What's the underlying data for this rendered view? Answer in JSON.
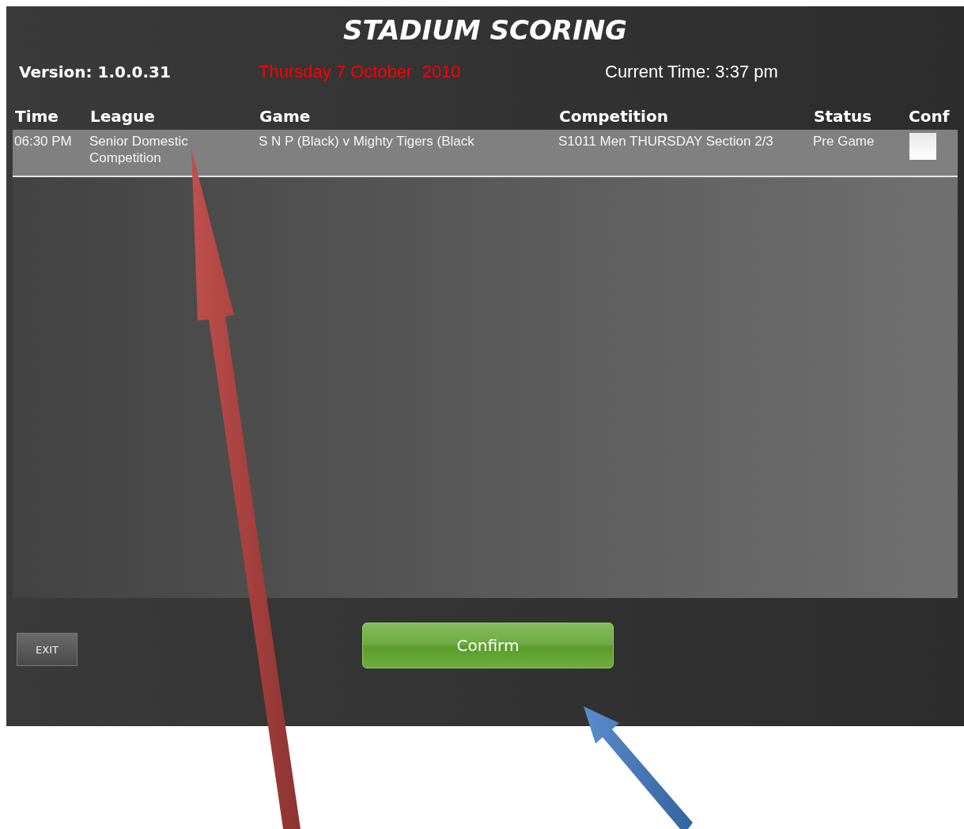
{
  "title": "STADIUM SCORING",
  "version": "Version: 1.0.0.31",
  "date": "Thursday 7 October  2010",
  "current_time": "Current Time: 3:37 pm",
  "table": {
    "columns": [
      "Time",
      "League",
      "Game",
      "Competition",
      "Status",
      "Conf"
    ],
    "rows": [
      {
        "time": "06:30 PM",
        "league": "Senior Domestic Competition",
        "game": "S N P (Black) v Mighty Tigers (Black",
        "competition": "S1011 Men THURSDAY Section 2/3",
        "status": "Pre Game",
        "checked": false
      }
    ]
  },
  "buttons": {
    "exit": "EXIT",
    "confirm": "Confirm"
  }
}
